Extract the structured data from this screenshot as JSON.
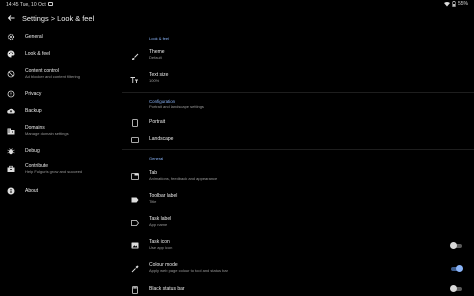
{
  "status_bar": {
    "time": "14:45",
    "date": "Tue, 10 Oct",
    "battery": "55%"
  },
  "app_bar": {
    "title": "Settings > Look & feel"
  },
  "sidebar": {
    "items": [
      {
        "label": "General",
        "subtitle": "",
        "icon": "gear-icon"
      },
      {
        "label": "Look & feel",
        "subtitle": "",
        "icon": "palette-icon"
      },
      {
        "label": "Content control",
        "subtitle": "Ad blocker and content filtering",
        "icon": "block-icon"
      },
      {
        "label": "Privacy",
        "subtitle": "",
        "icon": "privacy-icon"
      },
      {
        "label": "Backup",
        "subtitle": "",
        "icon": "cloud-upload-icon"
      },
      {
        "label": "Domains",
        "subtitle": "Manage domain settings",
        "icon": "domain-icon"
      },
      {
        "label": "Debug",
        "subtitle": "",
        "icon": "bug-icon"
      },
      {
        "label": "Contribute",
        "subtitle": "Help Fulguris grow and succeed",
        "icon": "toolbox-icon"
      },
      {
        "label": "About",
        "subtitle": "",
        "icon": "info-icon"
      }
    ]
  },
  "sections": {
    "look": "Look & feel",
    "configuration": "Configuration",
    "configuration_sub": "Portrait and landscape settings",
    "general": "General"
  },
  "prefs": {
    "theme": {
      "title": "Theme",
      "summary": "Default",
      "icon": "brush-icon"
    },
    "text_size": {
      "title": "Text size",
      "summary": "100%",
      "icon": "text-size-icon"
    },
    "portrait": {
      "title": "Portrait",
      "icon": "portrait-icon"
    },
    "landscape": {
      "title": "Landscape",
      "icon": "landscape-icon"
    },
    "tab": {
      "title": "Tab",
      "summary": "Animations, feedback and appearance",
      "icon": "tab-icon"
    },
    "toolbar_label": {
      "title": "Toolbar label",
      "summary": "Title",
      "icon": "label-icon"
    },
    "task_label": {
      "title": "Task label",
      "summary": "App name",
      "icon": "label-outline-icon"
    },
    "task_icon": {
      "title": "Task icon",
      "summary": "Use app icon",
      "icon": "image-icon",
      "enabled": false
    },
    "colour_mode": {
      "title": "Colour mode",
      "summary": "Apply web page colour to tool and status bar",
      "icon": "colorize-icon",
      "enabled": true
    },
    "black_status_bar": {
      "title": "Black status bar",
      "icon": "phone-icon",
      "enabled": false
    }
  },
  "colors": {
    "accent": "#8ab4f8",
    "background": "#000000"
  }
}
